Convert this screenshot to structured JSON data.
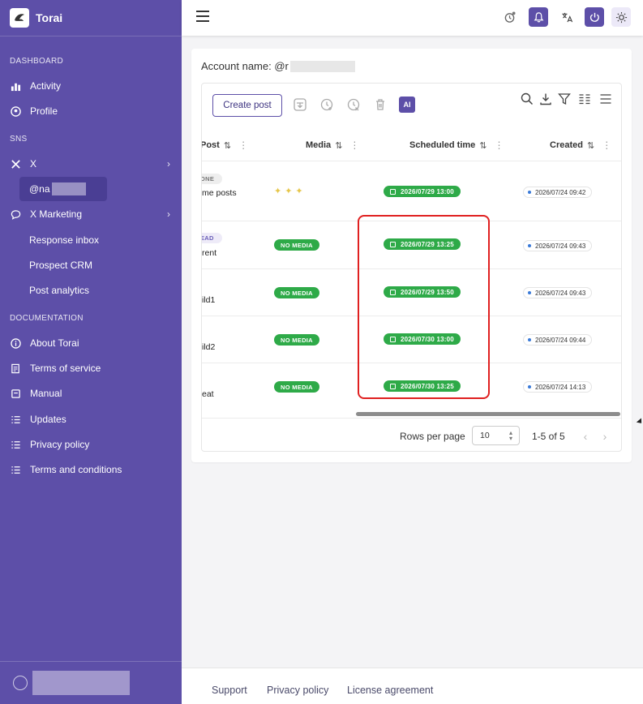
{
  "app": {
    "name": "Torai"
  },
  "sidebar": {
    "sections": {
      "dashboard": "DASHBOARD",
      "sns": "SNS",
      "documentation": "DOCUMENTATION"
    },
    "dashboard_items": [
      {
        "label": "Activity",
        "icon": "bar-chart-icon"
      },
      {
        "label": "Profile",
        "icon": "user-circle-icon"
      }
    ],
    "sns_items": {
      "x": "X",
      "account": "@na",
      "x_marketing": "X Marketing",
      "response_inbox": "Response inbox",
      "prospect_crm": "Prospect CRM",
      "post_analytics": "Post analytics"
    },
    "doc_items": [
      {
        "label": "About Torai",
        "icon": "info-icon"
      },
      {
        "label": "Terms of service",
        "icon": "document-icon"
      },
      {
        "label": "Manual",
        "icon": "book-icon"
      },
      {
        "label": "Updates",
        "icon": "list-icon"
      },
      {
        "label": "Privacy policy",
        "icon": "list-icon"
      },
      {
        "label": "Terms and conditions",
        "icon": "list-icon"
      }
    ]
  },
  "main": {
    "account_label": "Account name: @r",
    "create_post": "Create post",
    "ai_label": "AI",
    "columns": {
      "post": "Post",
      "media": "Media",
      "scheduled": "Scheduled time",
      "created": "Created"
    },
    "rows": [
      {
        "tag": "ONE",
        "title": "me posts",
        "media": "",
        "scheduled": "2026/07/29 13:00",
        "created": "2026/07/24 09:42"
      },
      {
        "tag": "EAD",
        "title": "rent",
        "media": "NO MEDIA",
        "scheduled": "2026/07/29 13:25",
        "created": "2026/07/24 09:43"
      },
      {
        "tag": "",
        "title": "ild1",
        "media": "NO MEDIA",
        "scheduled": "2026/07/29 13:50",
        "created": "2026/07/24 09:43"
      },
      {
        "tag": "",
        "title": "ild2",
        "media": "NO MEDIA",
        "scheduled": "2026/07/30 13:00",
        "created": "2026/07/24 09:44"
      },
      {
        "tag": "",
        "title": "eat",
        "media": "NO MEDIA",
        "scheduled": "2026/07/30 13:25",
        "created": "2026/07/24 14:13"
      }
    ],
    "pagination": {
      "rows_per_page_label": "Rows per page",
      "rows_per_page_value": "10",
      "range": "1-5 of 5"
    }
  },
  "footer": {
    "support": "Support",
    "privacy": "Privacy policy",
    "license": "License agreement"
  },
  "colors": {
    "sidebar": "#5d4fa8",
    "accent": "#5d4fa8",
    "status_green": "#2eaa48",
    "highlight_red": "#e02020"
  }
}
